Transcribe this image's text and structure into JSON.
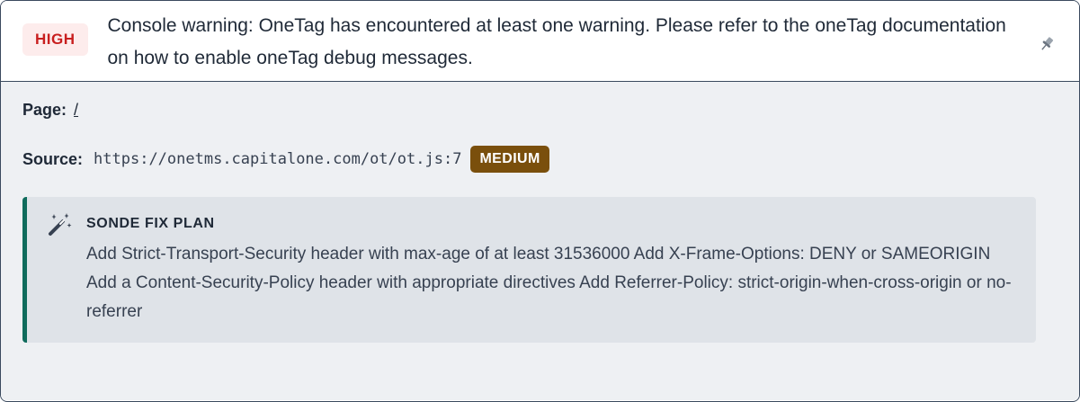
{
  "issue": {
    "severity_label": "HIGH",
    "title": "Console warning: OneTag has encountered at least one warning. Please refer to the oneTag documentation on how to enable oneTag debug messages.",
    "pin_icon": "pin-icon"
  },
  "details": {
    "page_label": "Page:",
    "page_value": "/",
    "source_label": "Source:",
    "source_value": "https://onetms.capitalone.com/ot/ot.js:7",
    "source_severity": "MEDIUM"
  },
  "fix_plan": {
    "icon": "magic-wand-icon",
    "title": "SONDE FIX PLAN",
    "text": "Add Strict-Transport-Security header with max-age of at least 31536000 Add X-Frame-Options: DENY or SAMEORIGIN Add a Content-Security-Policy header with appropriate directives Add Referrer-Policy: strict-origin-when-cross-origin or no-referrer"
  },
  "colors": {
    "high_bg": "#fdecec",
    "high_text": "#c81e1e",
    "medium_bg": "#7a4f0c",
    "fix_accent": "#0f6b5c"
  }
}
